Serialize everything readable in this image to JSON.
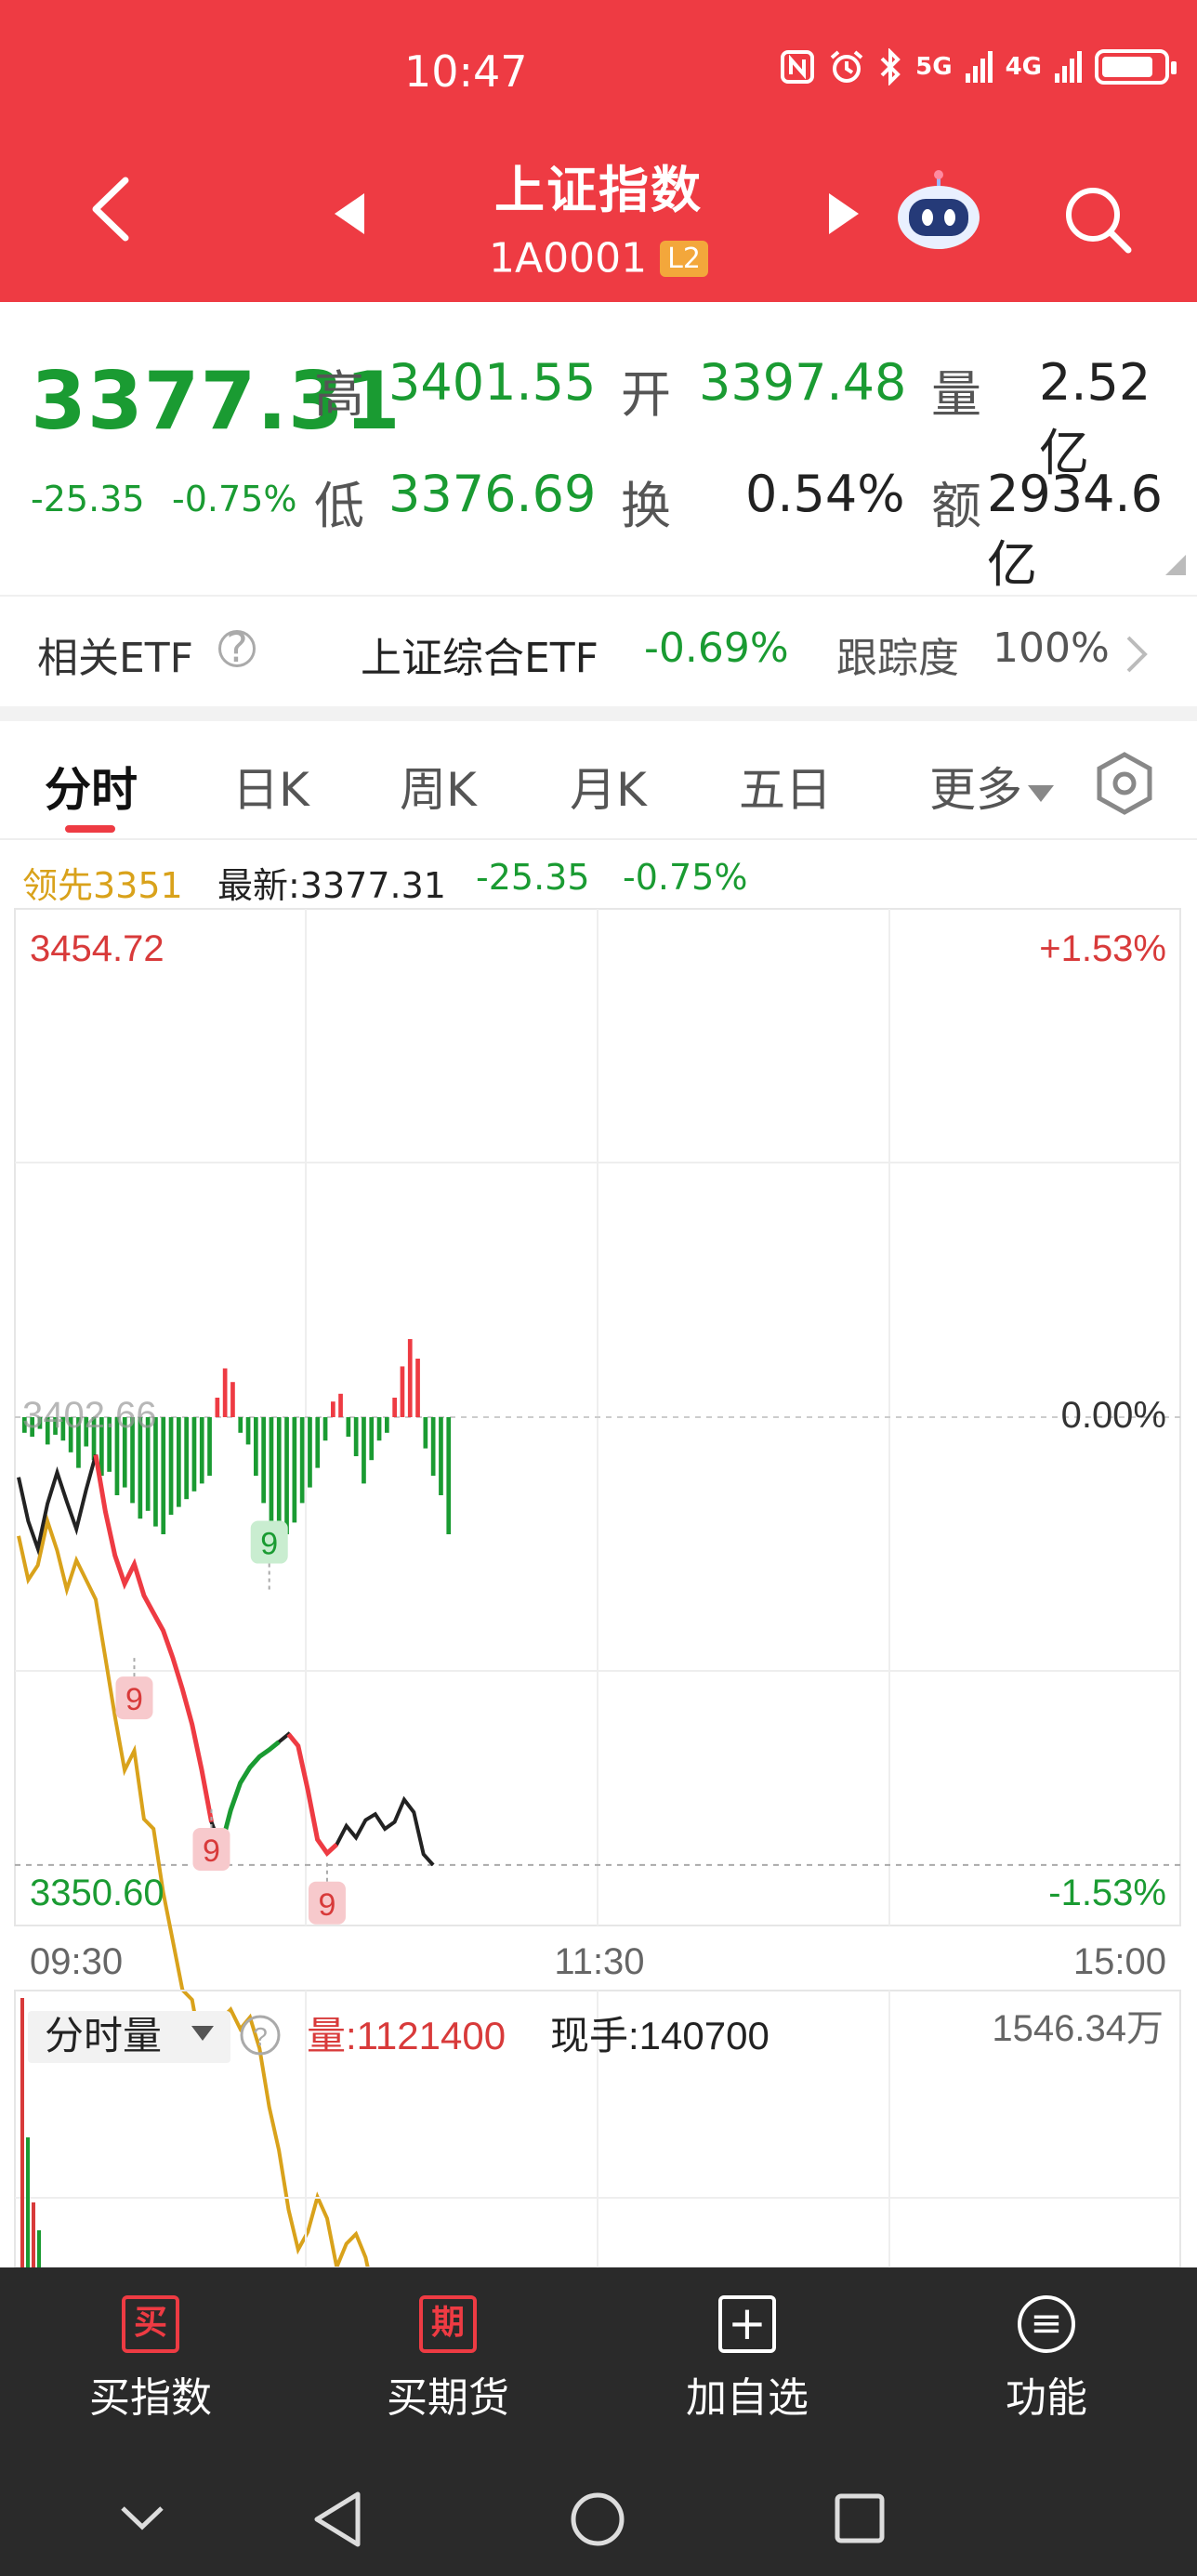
{
  "status_bar": {
    "time": "10:47",
    "net1": "5G",
    "net2": "4G"
  },
  "header": {
    "title": "上证指数",
    "code": "1A0001",
    "level_badge": "L2"
  },
  "quote": {
    "price": "3377.31",
    "change": "-25.35",
    "change_pct": "-0.75%",
    "high_label": "高",
    "high": "3401.55",
    "open_label": "开",
    "open": "3397.48",
    "volume_label": "量",
    "volume": "2.52亿",
    "low_label": "低",
    "low": "3376.69",
    "turnover_label": "换",
    "turnover": "0.54%",
    "amount_label": "额",
    "amount": "2934.6亿"
  },
  "etf": {
    "label": "相关ETF",
    "help": "?",
    "name": "上证综合ETF",
    "pct": "-0.69%",
    "tracking_label": "跟踪度",
    "tracking_value": "100%"
  },
  "tabs": [
    "分时",
    "日K",
    "周K",
    "月K",
    "五日",
    "更多"
  ],
  "legend": {
    "leading": "领先3351",
    "latest": "最新:3377.31",
    "change": "-25.35",
    "change_pct": "-0.75%"
  },
  "colors": {
    "red": "#ee3b43",
    "green": "#1a9b32",
    "leading": "#d9a21b",
    "price": "#222222"
  },
  "chart_data": {
    "type": "line",
    "y_max_label": "3454.72",
    "y_min_label": "3350.60",
    "pct_max_label": "+1.53%",
    "pct_zero_label": "0.00%",
    "pct_min_label": "-1.53%",
    "prev_close_label": "3402.66",
    "x_ticks": [
      "09:30",
      "11:30",
      "15:00"
    ],
    "ylim": [
      3350.6,
      3454.72
    ],
    "prev_close": 3402.66,
    "price_series": [
      3396.5,
      3392.0,
      3389.2,
      3393.8,
      3397.0,
      3394.0,
      3391.2,
      3395.2,
      3398.8,
      3393.0,
      3388.5,
      3385.6,
      3387.6,
      3384.4,
      3382.6,
      3380.8,
      3378.0,
      3374.8,
      3371.2,
      3366.5,
      3361.2,
      3358.6,
      3362.4,
      3365.2,
      3366.8,
      3367.9,
      3368.6,
      3369.4,
      3370.2,
      3369.0,
      3364.5,
      3359.4,
      3358.0,
      3358.9,
      3360.8,
      3359.6,
      3361.4,
      3362.0,
      3360.5,
      3361.2,
      3363.5,
      3362.2,
      3357.9,
      3356.8
    ],
    "leading_series": [
      3390.5,
      3386.0,
      3387.5,
      3392.0,
      3389.0,
      3385.0,
      3388.0,
      3386.0,
      3384.0,
      3378.0,
      3372.0,
      3366.5,
      3368.5,
      3361.5,
      3360.5,
      3354.0,
      3349.0,
      3344.0,
      3343.0,
      3337.5,
      3338.0,
      3341.0,
      3342.0,
      3340.0,
      3341.2,
      3338.0,
      3332.0,
      3327.6,
      3321.5,
      3317.4,
      3319.2,
      3322.8,
      3320.6,
      3315.6,
      3318.0,
      3319.0,
      3316.6,
      3312.0,
      3313.2,
      3311.7,
      3305.5,
      3297.0,
      3290.0
    ],
    "signal_bars": [
      -8,
      -10,
      -6,
      -14,
      -9,
      -12,
      -18,
      -26,
      -15,
      -22,
      -30,
      -28,
      -40,
      -36,
      -44,
      -52,
      -48,
      -56,
      -60,
      -50,
      -46,
      -42,
      -38,
      -34,
      -30,
      10,
      25,
      18,
      -8,
      -14,
      -30,
      -44,
      -58,
      -64,
      -60,
      -54,
      -44,
      -36,
      -26,
      -12,
      8,
      12,
      -10,
      -20,
      -34,
      -22,
      -12,
      -8,
      10,
      26,
      40,
      30,
      -16,
      -30,
      -40,
      -60
    ],
    "markers": [
      {
        "label": "9",
        "x_index": 12,
        "value": 3378.0,
        "side": "below",
        "color": "red"
      },
      {
        "label": "9",
        "x_index": 20,
        "value": 3362.5,
        "side": "below",
        "color": "red"
      },
      {
        "label": "9",
        "x_index": 26,
        "value": 3385.0,
        "side": "above",
        "color": "green"
      },
      {
        "label": "9",
        "x_index": 32,
        "value": 3357.0,
        "side": "below",
        "color": "red"
      }
    ]
  },
  "volume_panel": {
    "selector": "分时量",
    "help": "?",
    "volume": "量:1121400",
    "last_hand": "现手:140700",
    "max_label": "1546.34万"
  },
  "bottom_bar": [
    {
      "icon": "买",
      "label": "买指数"
    },
    {
      "icon": "期",
      "label": "买期货"
    },
    {
      "icon": "+",
      "label": "加自选"
    },
    {
      "icon": "≡",
      "label": "功能"
    }
  ]
}
